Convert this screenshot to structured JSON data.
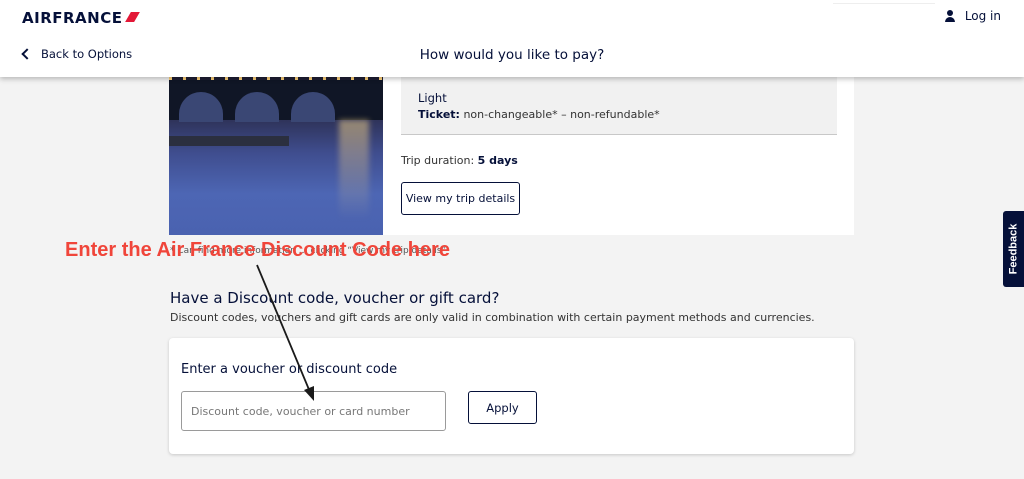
{
  "header": {
    "logo": "AIRFRANCE",
    "login_label": "Log in",
    "back_label": "Back to Options",
    "page_title": "How would you like to pay?"
  },
  "trip": {
    "fare_name": "Light",
    "ticket_label": "Ticket:",
    "ticket_value": "non-changeable* – non-refundable*",
    "duration_label": "Trip duration:",
    "duration_value": "5 days",
    "view_button": "View my trip details",
    "footnote": "* Can find more information … clicking “View my trip details”"
  },
  "annotation": {
    "text": "Enter the Air France Discount Code here",
    "color": "#f0453a"
  },
  "discount": {
    "title": "Have a Discount code, voucher or gift card?",
    "subtitle": "Discount codes, vouchers and gift cards are only valid in combination with certain payment methods and currencies.",
    "card_label": "Enter a voucher or discount code",
    "input_placeholder": "Discount code, voucher or card number",
    "input_value": "",
    "apply_button": "Apply"
  },
  "feedback_tab": "Feedback",
  "colors": {
    "brand_navy": "#051039",
    "brand_red": "#e31837",
    "background": "#f3f3f3"
  },
  "icons": {
    "user": "user-icon",
    "back": "chevron-left-icon"
  }
}
